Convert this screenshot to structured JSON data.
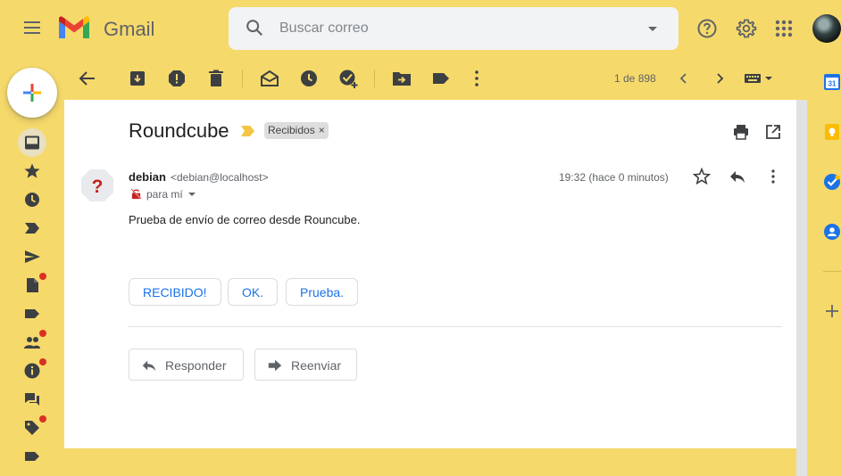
{
  "app": {
    "brand": "Gmail"
  },
  "search": {
    "placeholder": "Buscar correo"
  },
  "toolbar": {
    "pager": "1 de 898"
  },
  "message": {
    "subject": "Roundcube",
    "label": "Recibidos",
    "label_close": "×",
    "sender_name": "debian",
    "sender_email": "<debian@localhost>",
    "to": "para mí",
    "time": "19:32 (hace 0 minutos)",
    "body": "Prueba de envío de correo desde Rouncube."
  },
  "smart_replies": [
    "RECIBIDO!",
    "OK.",
    "Prueba."
  ],
  "actions": {
    "reply": "Responder",
    "forward": "Reenviar"
  },
  "colors": {
    "background": "#f6d96b",
    "accent": "#1a73e8",
    "badge": "#d93025"
  }
}
